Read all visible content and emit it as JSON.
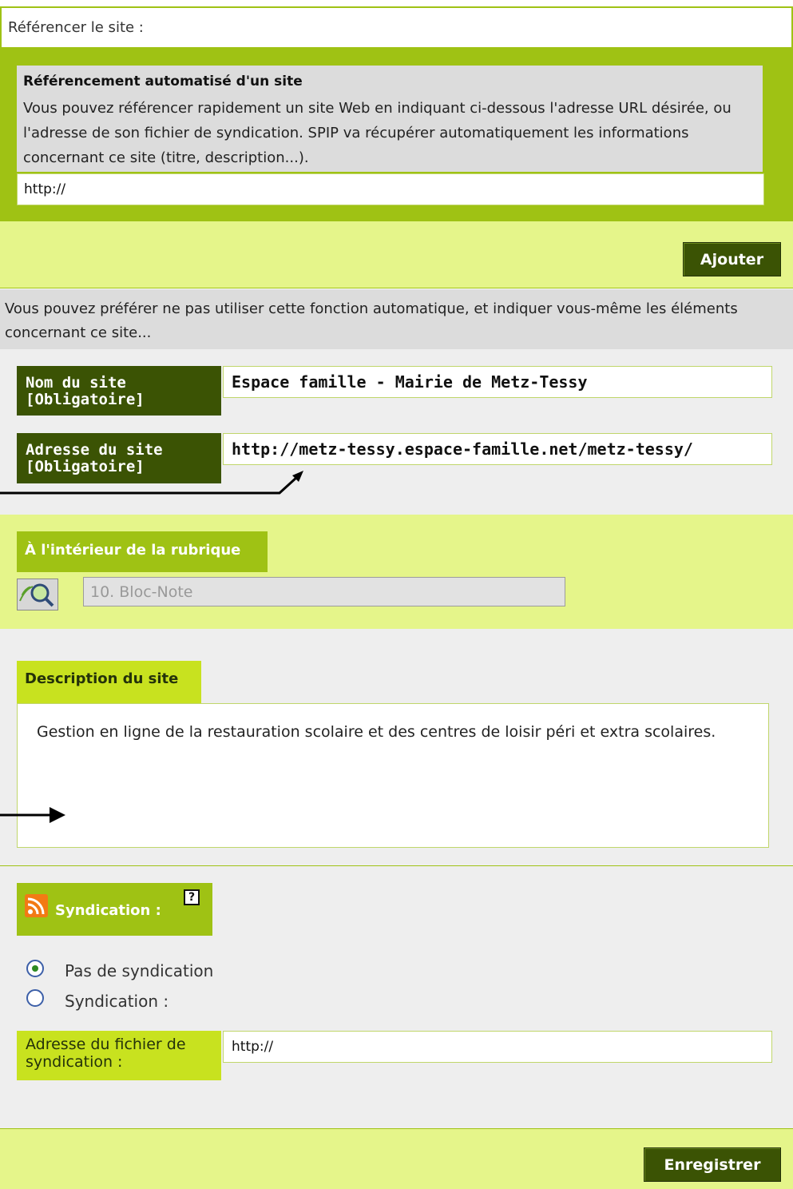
{
  "header": {
    "title": "Référencer le site :"
  },
  "auto": {
    "title": "Référencement automatisé d'un site",
    "description": "Vous pouvez référencer rapidement un site Web en indiquant ci-dessous l'adresse URL désirée, ou l'adresse de son fichier de syndication. SPIP va récupérer automatiquement les informations concernant ce site (titre, description...).",
    "url_value": "http://",
    "add_button": "Ajouter"
  },
  "manual": {
    "intro": "Vous pouvez préférer ne pas utiliser cette fonction automatique, et indiquer vous-même les éléments concernant ce site...",
    "name_label": "Nom du site [Obligatoire]",
    "name_value": "Espace famille - Mairie de Metz-Tessy",
    "address_label": "Adresse du site [Obligatoire]",
    "address_value": "http://metz-tessy.espace-famille.net/metz-tessy/"
  },
  "rubrique": {
    "title": "À l'intérieur de la rubrique",
    "value": "10. Bloc-Note",
    "search_icon": "search-magnifier-icon"
  },
  "description": {
    "title": "Description du site",
    "text": "Gestion en ligne de la restauration scolaire et des centres de loisir péri et extra scolaires."
  },
  "syndication": {
    "title": "Syndication :",
    "help": "?",
    "rss_icon": "rss-icon",
    "option_none": "Pas de syndication",
    "option_syndication": "Syndication :",
    "selected": "none",
    "feed_label": "Adresse du fichier de syndication :",
    "feed_value": "http://"
  },
  "footer": {
    "save_button": "Enregistrer"
  },
  "colors": {
    "accent_green": "#9fc214",
    "dark_green": "#3b5304",
    "light_green": "#e5f58a",
    "lime": "#c8e21f"
  }
}
